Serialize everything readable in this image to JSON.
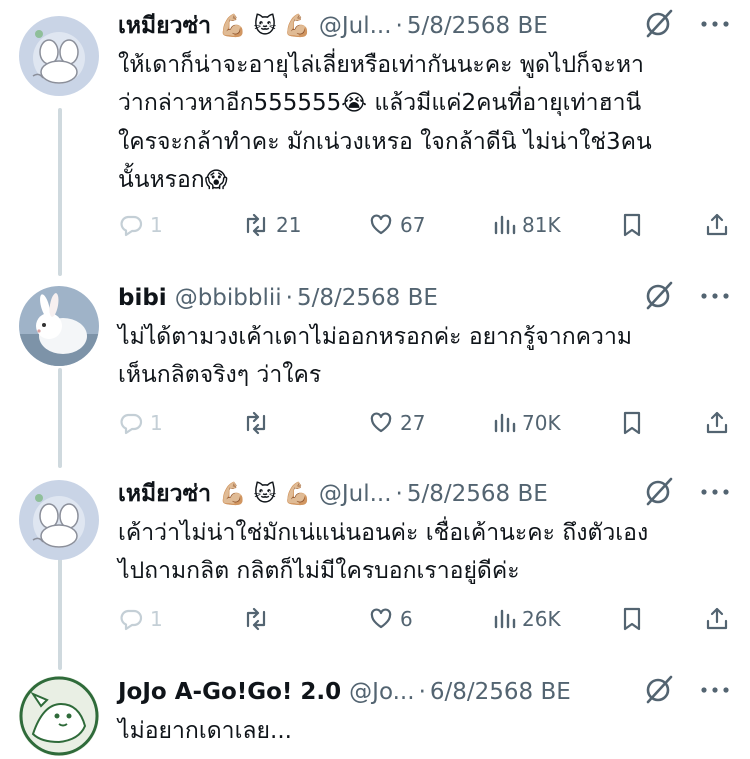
{
  "posts": [
    {
      "display_name": "เหมียวซ่า",
      "name_emojis": [
        "💪🏼",
        "🐱",
        "💪🏼"
      ],
      "handle": "@Jul...",
      "separator": "·",
      "date": "5/8/2568 BE",
      "text_lines": [
        "ให้เดาก็น่าจะอายุไล่เลี่ยหรือเท่ากันนะคะ พูดไปก็จะหา",
        "ว่ากล่าวหาอีก555555",
        "😭",
        " แล้วมีแค่2คนที่อายุเท่าฮานี",
        "ใครจะกล้าทำคะ มักเน่วงเหรอ ใจกล้าดีนิ ไม่น่าใช่3คน",
        "นั้นหรอก",
        "😱"
      ],
      "replies": "1",
      "reposts": "21",
      "likes": "67",
      "views": "81K"
    },
    {
      "display_name": "bibi",
      "handle": "@bbibblii",
      "separator": "·",
      "date": "5/8/2568 BE",
      "text_lines": [
        "ไม่ได้ตามวงเค้าเดาไม่ออกหรอกค่ะ อยากรู้จากความ",
        "เห็นกลิตจริงๆ ว่าใคร"
      ],
      "replies": "1",
      "reposts": "",
      "likes": "27",
      "views": "70K"
    },
    {
      "display_name": "เหมียวซ่า",
      "name_emojis": [
        "💪🏼",
        "🐱",
        "💪🏼"
      ],
      "handle": "@Jul...",
      "separator": "·",
      "date": "5/8/2568 BE",
      "text_lines": [
        "เค้าว่าไม่น่าใช่มักเน่แน่นอนค่ะ เชื่อเค้านะคะ ถึงตัวเอง",
        "ไปถามกลิต กลิตก็ไม่มีใครบอกเราอยู่ดีค่ะ"
      ],
      "replies": "1",
      "reposts": "",
      "likes": "6",
      "views": "26K"
    },
    {
      "display_name": "JoJo A-Go!Go! 2.0",
      "handle": "@Jo...",
      "separator": "·",
      "date": "6/8/2568 BE",
      "text_lines": [
        "ไม่อยากเดาเลย..."
      ]
    }
  ],
  "colors": {
    "text": "#0f1419",
    "secondary": "#536471",
    "muted": "#c4cfd6",
    "thread_line": "#cfd9de"
  },
  "icons": {
    "grok": "grok-icon",
    "more": "more-icon",
    "reply": "reply-icon",
    "repost": "repost-icon",
    "like": "like-icon",
    "views": "views-icon",
    "bookmark": "bookmark-icon",
    "share": "share-icon"
  }
}
